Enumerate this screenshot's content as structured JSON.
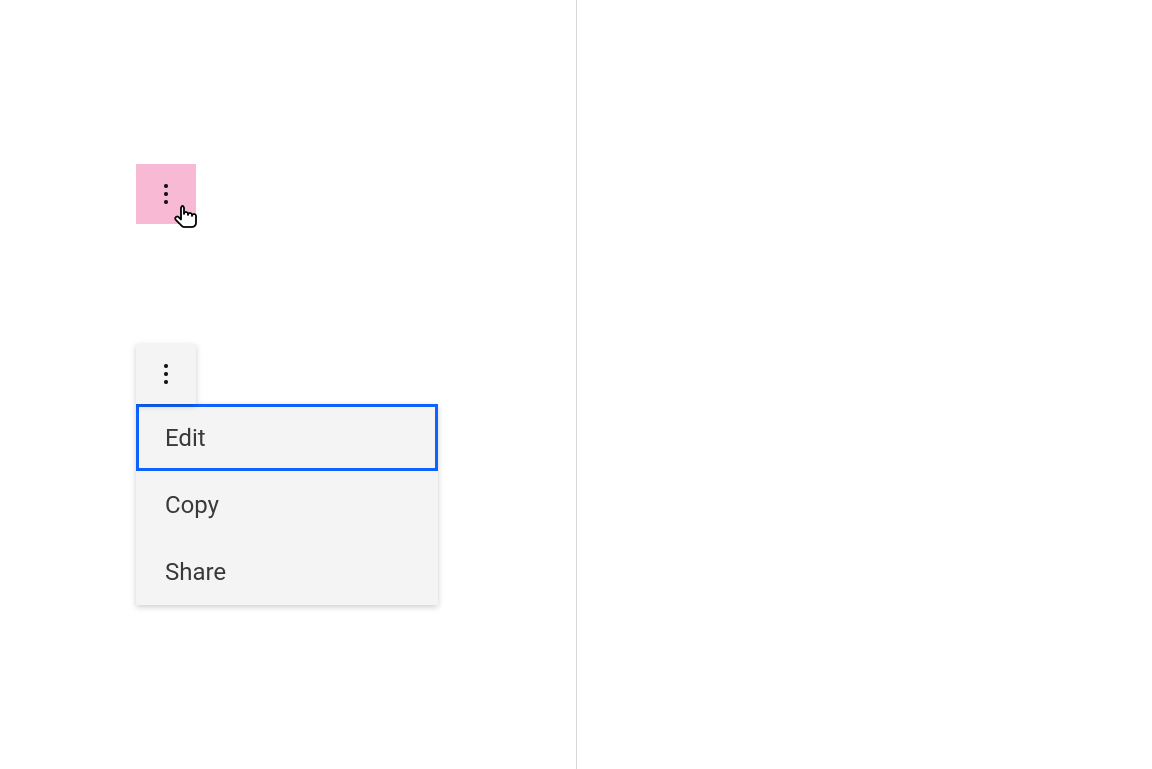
{
  "menu": {
    "items": [
      {
        "label": "Edit"
      },
      {
        "label": "Copy"
      },
      {
        "label": "Share"
      }
    ]
  },
  "icons": {
    "kebab": "kebab-icon"
  }
}
